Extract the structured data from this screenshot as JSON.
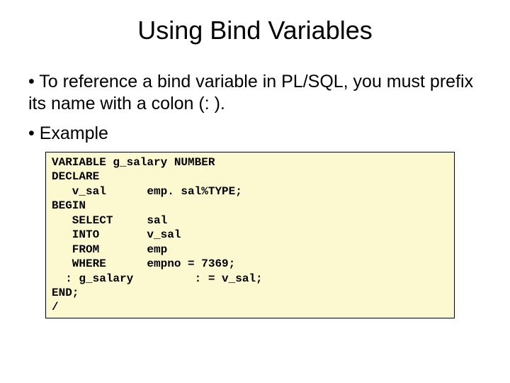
{
  "title": "Using Bind Variables",
  "bullets": {
    "b1": "• To reference a bind variable in PL/SQL, you must prefix its name with a colon (: ).",
    "b2": "• Example"
  },
  "code": "VARIABLE g_salary NUMBER\nDECLARE\n   v_sal      emp. sal%TYPE;\nBEGIN\n   SELECT     sal\n   INTO       v_sal\n   FROM       emp\n   WHERE      empno = 7369;\n  : g_salary         : = v_sal;\nEND;\n/"
}
